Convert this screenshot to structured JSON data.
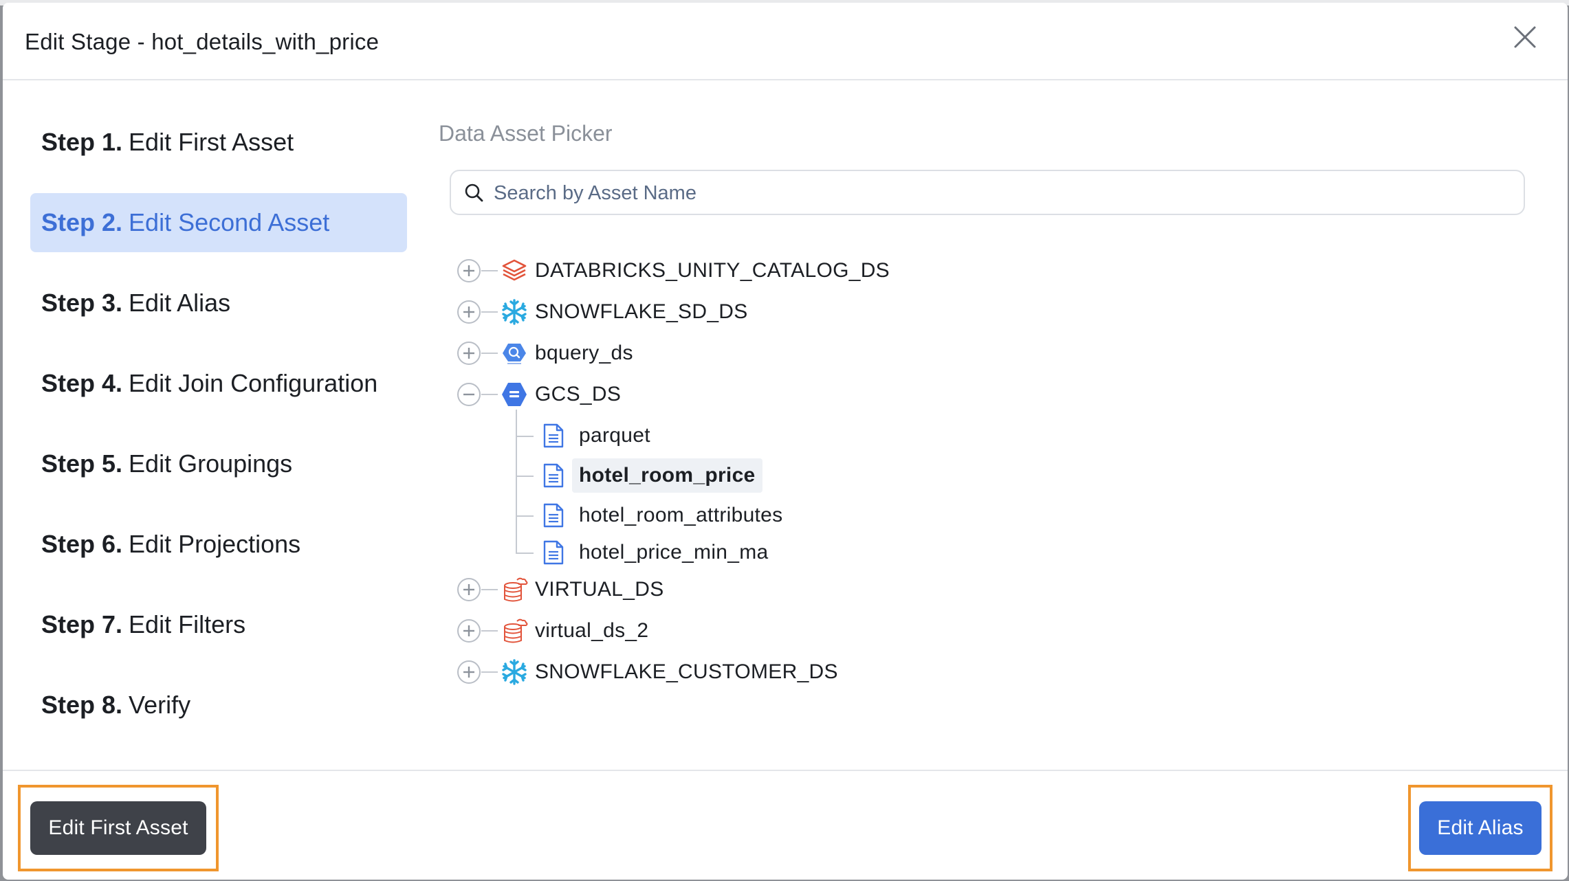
{
  "modal": {
    "title": "Edit Stage - hot_details_with_price"
  },
  "steps": [
    {
      "num": "Step 1.",
      "label": "Edit First Asset",
      "active": false
    },
    {
      "num": "Step 2.",
      "label": "Edit Second Asset",
      "active": true
    },
    {
      "num": "Step 3.",
      "label": "Edit Alias",
      "active": false
    },
    {
      "num": "Step 4.",
      "label": "Edit Join Configuration",
      "active": false
    },
    {
      "num": "Step 5.",
      "label": "Edit Groupings",
      "active": false
    },
    {
      "num": "Step 6.",
      "label": "Edit Projections",
      "active": false
    },
    {
      "num": "Step 7.",
      "label": "Edit Filters",
      "active": false
    },
    {
      "num": "Step 8.",
      "label": "Verify",
      "active": false
    }
  ],
  "picker": {
    "title": "Data Asset Picker",
    "search_placeholder": "Search by Asset Name"
  },
  "tree": {
    "datasources": [
      {
        "label": "DATABRICKS_UNITY_CATALOG_DS",
        "icon": "databricks-icon",
        "expanded": false
      },
      {
        "label": "SNOWFLAKE_SD_DS",
        "icon": "snowflake-icon",
        "expanded": false
      },
      {
        "label": "bquery_ds",
        "icon": "bigquery-icon",
        "expanded": false
      },
      {
        "label": "GCS_DS",
        "icon": "gcs-icon",
        "expanded": true
      },
      {
        "label": "VIRTUAL_DS",
        "icon": "virtual-db-icon",
        "expanded": false
      },
      {
        "label": "virtual_ds_2",
        "icon": "virtual-db-icon",
        "expanded": false
      },
      {
        "label": "SNOWFLAKE_CUSTOMER_DS",
        "icon": "snowflake-icon",
        "expanded": false
      }
    ],
    "gcs_children": [
      {
        "label": "parquet",
        "selected": false
      },
      {
        "label": "hotel_room_price",
        "selected": true
      },
      {
        "label": "hotel_room_attributes",
        "selected": false
      },
      {
        "label": "hotel_price_min_ma",
        "selected": false
      }
    ]
  },
  "footer": {
    "prev_label": "Edit First Asset",
    "next_label": "Edit Alias"
  },
  "colors": {
    "accent": "#3a6fd8",
    "active_step_bg": "#d4e2fb",
    "highlight_outline": "#f0962e",
    "prev_button": "#3f4249"
  }
}
